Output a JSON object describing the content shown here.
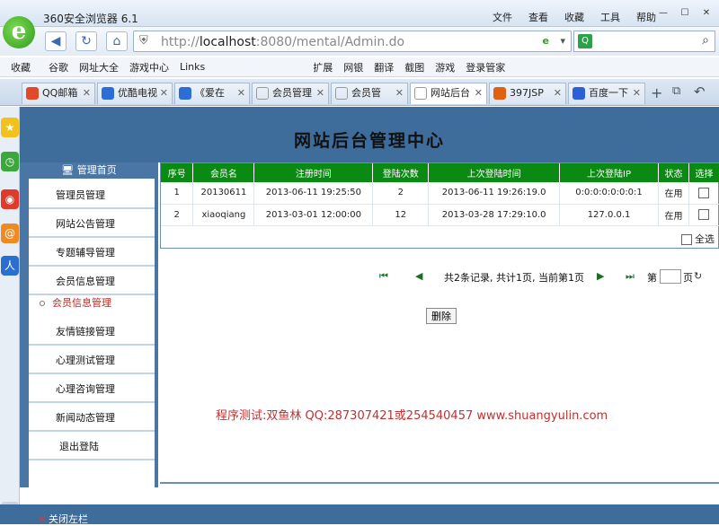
{
  "browser": {
    "title": "360安全浏览器 6.1",
    "menus": [
      "文件",
      "查看",
      "收藏",
      "工具",
      "帮助"
    ],
    "url_prefix": "http://",
    "url_host": "localhost",
    "url_rest": ":8080/mental/Admin.do",
    "favorites": [
      "收藏",
      "谷歌",
      "网址大全",
      "游戏中心",
      "Links",
      "扩展",
      "网银",
      "翻译",
      "截图",
      "游戏",
      "登录管家"
    ],
    "tabs": [
      {
        "label": "QQ邮箱",
        "icon_color": "#e04a2a"
      },
      {
        "label": "优酷电视",
        "icon_color": "#2b6fd6"
      },
      {
        "label": "《爱在",
        "icon_color": "#2b6fd6"
      },
      {
        "label": "会员管理",
        "icon_color": "#888888"
      },
      {
        "label": "会员管",
        "icon_color": "#888888"
      },
      {
        "label": "网站后台",
        "icon_color": "#888888"
      },
      {
        "label": "397JSP",
        "icon_color": "#e06010"
      },
      {
        "label": "百度一下",
        "icon_color": "#2c60d8"
      }
    ]
  },
  "page": {
    "title": "网站后台管理中心",
    "menu_head": "管理首页",
    "menu": [
      "管理员管理",
      "网站公告管理",
      "专题辅导管理",
      "会员信息管理",
      "会员信息管理",
      "友情链接管理",
      "心理测试管理",
      "心理咨询管理",
      "新闻动态管理",
      "退出登陆"
    ],
    "table": {
      "headers": [
        "序号",
        "会员名",
        "注册时间",
        "登陆次数",
        "上次登陆时间",
        "上次登陆IP",
        "状态",
        "选择"
      ],
      "rows": [
        [
          "1",
          "20130611",
          "2013-06-11 19:25:50",
          "2",
          "2013-06-11 19:26:19.0",
          "0:0:0:0:0:0:0:1",
          "在用"
        ],
        [
          "2",
          "xiaoqiang",
          "2013-03-01 12:00:00",
          "12",
          "2013-03-28 17:29:10.0",
          "127.0.0.1",
          "在用"
        ]
      ]
    },
    "select_all": "全选",
    "pager_text": "共2条记录, 共计1页, 当前第1页",
    "pager_goto_pre": "第",
    "pager_goto_post": "页",
    "delete_button": "删除",
    "note": "程序测试:双鱼林 QQ:287307421或254540457 www.shuangyulin.com",
    "close_sidebar": "关闭左栏"
  }
}
